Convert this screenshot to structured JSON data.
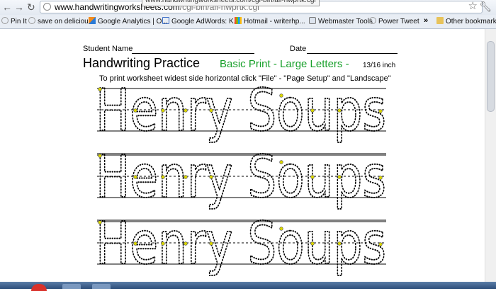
{
  "browser": {
    "url_main": "www.handwritingworksheets.com",
    "url_path": "/cgi-bin/all-hwprtk.cgi",
    "tooltip": "www.handwritingworksheets.com/cgi-bin/all-hwprtk.cgi"
  },
  "bookmarks": [
    {
      "label": "Pin It",
      "icon": "pin-icon"
    },
    {
      "label": "save on delicious",
      "icon": "globe-icon"
    },
    {
      "label": "Google Analytics | O...",
      "icon": "analytics-icon"
    },
    {
      "label": "Google AdWords: K...",
      "icon": "google-icon"
    },
    {
      "label": "Hotmail - writerhp...",
      "icon": "hotmail-icon"
    },
    {
      "label": "Webmaster Tools",
      "icon": "webmaster-icon"
    },
    {
      "label": "Power Tweet",
      "icon": "globe-icon"
    }
  ],
  "other_bookmarks": "Other bookmarks",
  "overflow": "»",
  "worksheet": {
    "student_label": "Student Name",
    "date_label": "Date",
    "title": "Handwriting Practice",
    "subtitle": "Basic Print - Large Letters -",
    "size": "13/16 inch",
    "instructions": "To print worksheet widest side horizontal click \"File\" - \"Page Setup\" and \"Landscape\"",
    "practice_text": "Henry Soups",
    "practice_rows": 3
  },
  "colors": {
    "subtitle": "#17a02a",
    "dot_marker": "#d8d400"
  }
}
